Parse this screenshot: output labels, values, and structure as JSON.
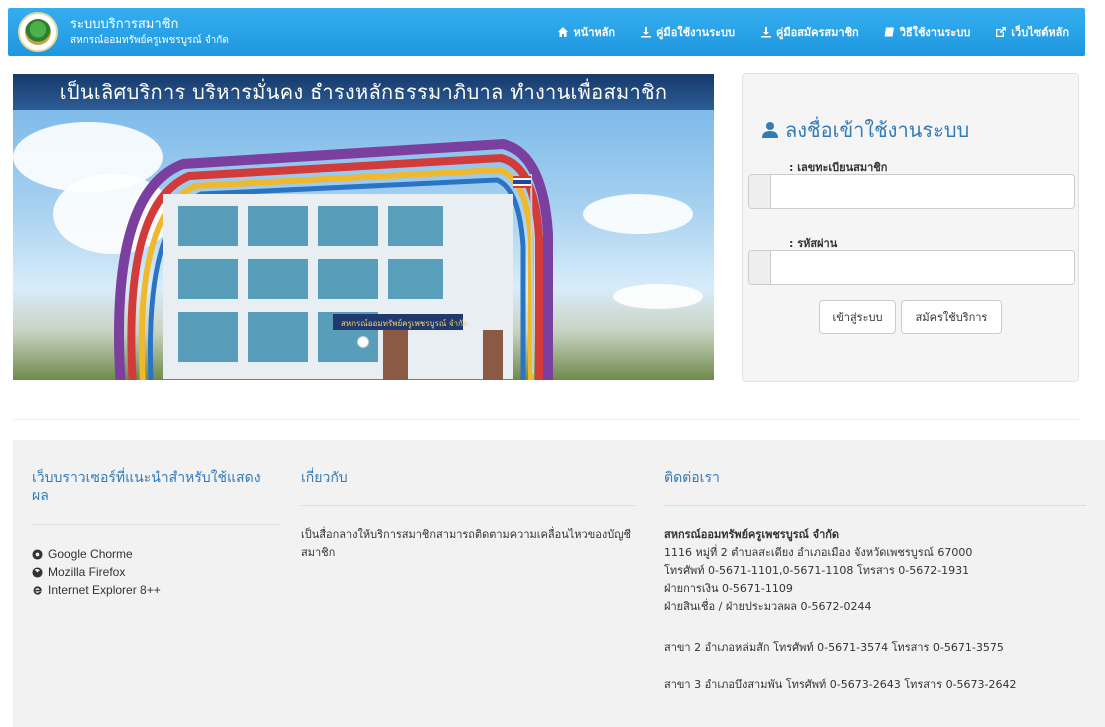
{
  "brand": {
    "title": "ระบบบริการสมาชิก",
    "subtitle": "สหกรณ์ออมทรัพย์ครูเพชรบูรณ์ จำกัด"
  },
  "nav": {
    "items": [
      {
        "label": "หน้าหลัก",
        "icon": "home-icon"
      },
      {
        "label": "คู่มือใช้งานระบบ",
        "icon": "download-icon"
      },
      {
        "label": "คู่มือสมัครสมาชิก",
        "icon": "download-icon"
      },
      {
        "label": "วิธีใช้งานระบบ",
        "icon": "book-icon"
      },
      {
        "label": "เว็บไซต์หลัก",
        "icon": "external-link-icon"
      }
    ]
  },
  "hero": {
    "banner_text": "เป็นเลิศบริการ บริหารมั่นคง ธำรงหลักธรรมาภิบาล ทำงานเพื่อสมาชิก",
    "sign_text": "สหกรณ์ออมทรัพย์ครูเพชรบูรณ์ จำกัด"
  },
  "login": {
    "title": "ลงชื่อเข้าใช้งานระบบ",
    "member_label": ": เลขทะเบียนสมาชิก",
    "member_value": "",
    "password_label": ": รหัสผ่าน",
    "password_value": "",
    "login_button": "เข้าสู่ระบบ",
    "register_button": "สมัครใช้บริการ"
  },
  "footer": {
    "browsers_heading": "เว็บบราวเซอร์ที่แนะนำสำหรับใช้แสดงผล",
    "browsers": [
      {
        "label": "Google Chorme",
        "icon": "chrome-icon"
      },
      {
        "label": "Mozilla Firefox",
        "icon": "firefox-icon"
      },
      {
        "label": "Internet Explorer 8++",
        "icon": "ie-icon"
      }
    ],
    "about_heading": "เกี่ยวกับ",
    "about_text": "เป็นสื่อกลางให้บริการสมาชิกสามารถติดตามความเคลื่อนไหวของบัญชีสมาชิก",
    "contact_heading": "ติดต่อเรา",
    "contact_org": "สหกรณ์ออมทรัพย์ครูเพชรบูรณ์ จำกัด",
    "contact_lines": [
      "1116 หมู่ที่ 2 ตำบลสะเดียง อำเภอเมือง จังหวัดเพชรบูรณ์ 67000",
      "โทรศัพท์ 0-5671-1101,0-5671-1108 โทรสาร 0-5672-1931",
      "ฝ่ายการเงิน 0-5671-1109",
      "ฝ่ายสินเชื่อ / ฝ่ายประมวลผล 0-5672-0244"
    ],
    "branch2": "สาขา 2 อำเภอหล่มสัก โทรศัพท์ 0-5671-3574 โทรสาร 0-5671-3575",
    "branch3": "สาขา 3 อำเภอบึงสามพัน โทรศัพท์ 0-5673-2643 โทรสาร 0-5673-2642"
  },
  "colors": {
    "nav_blue": "#1f97df",
    "link_blue": "#337ab7",
    "footer_bg": "#f2f2f2"
  }
}
